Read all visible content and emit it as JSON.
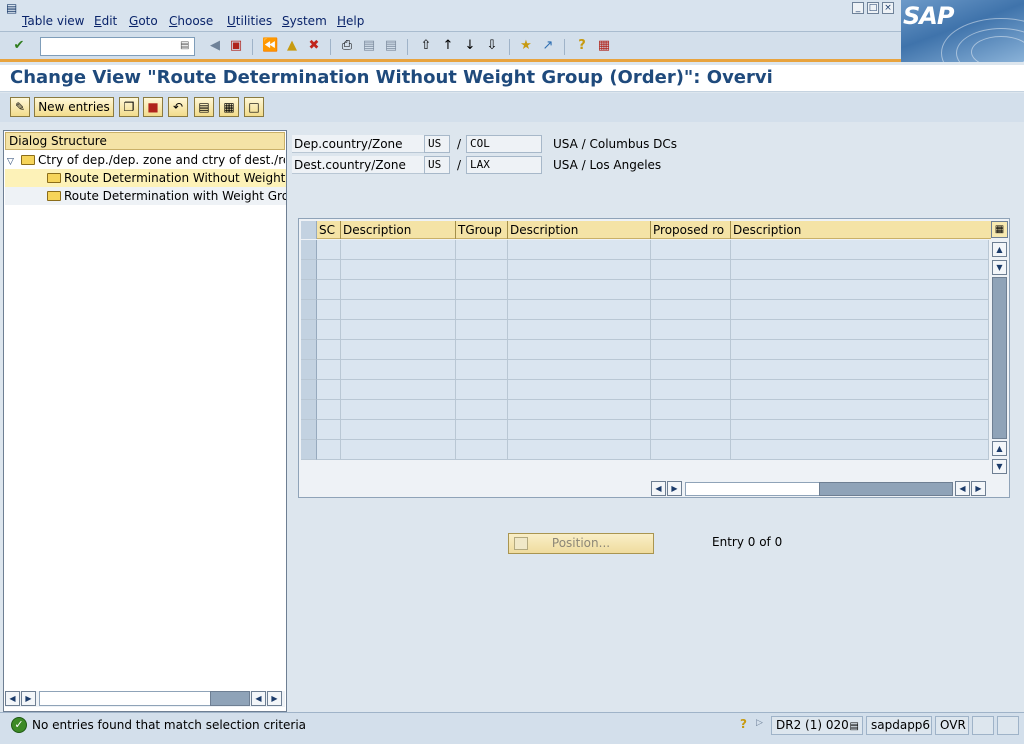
{
  "menubar": {
    "items": [
      {
        "label": "Table view"
      },
      {
        "label": "Edit"
      },
      {
        "label": "Goto"
      },
      {
        "label": "Choose"
      },
      {
        "label": "Utilities"
      },
      {
        "label": "System"
      },
      {
        "label": "Help"
      }
    ]
  },
  "logo": {
    "text": "SAP"
  },
  "toolbar": {
    "command_value": "",
    "icons": [
      "enter-icon",
      "back-icon",
      "save-icon",
      "green-back-icon",
      "exit-icon",
      "cancel-icon",
      "print-icon",
      "find-icon",
      "find-next-icon",
      "first-page-icon",
      "previous-page-icon",
      "next-page-icon",
      "last-page-icon",
      "create-session-icon",
      "create-shortcut-icon",
      "help-icon",
      "layout-menu-icon"
    ]
  },
  "title": "Change View \"Route Determination Without Weight Group (Order)\": Overvi",
  "app_toolbar": {
    "new_entries_label": "New entries"
  },
  "dialog_structure": {
    "header": "Dialog Structure",
    "items": [
      {
        "label": "Ctry of dep./dep. zone and ctry of dest./recv.z"
      },
      {
        "label": "Route Determination Without Weight Gro"
      },
      {
        "label": "Route Determination with Weight Group"
      }
    ]
  },
  "header_fields": [
    {
      "label": "Dep.country/Zone",
      "country": "US",
      "zone": "COL",
      "description": "USA / Columbus DCs"
    },
    {
      "label": "Dest.country/Zone",
      "country": "US",
      "zone": "LAX",
      "description": "USA / Los Angeles"
    }
  ],
  "separator": "/",
  "table": {
    "columns": [
      "SC",
      "Description",
      "TGroup",
      "Description",
      "Proposed ro",
      "Description"
    ],
    "rows": []
  },
  "position_button": "Position...",
  "entry_count": "Entry 0 of 0",
  "statusbar": {
    "message": "No entries found that match selection criteria",
    "system": "DR2 (1) 020",
    "server": "sapdapp6",
    "mode": "OVR"
  },
  "colors": {
    "accent_orange": "#e8a33e",
    "title_blue": "#1f4a7c",
    "header_yellow": "#f4e3a6",
    "status_green": "#3d8a26"
  }
}
